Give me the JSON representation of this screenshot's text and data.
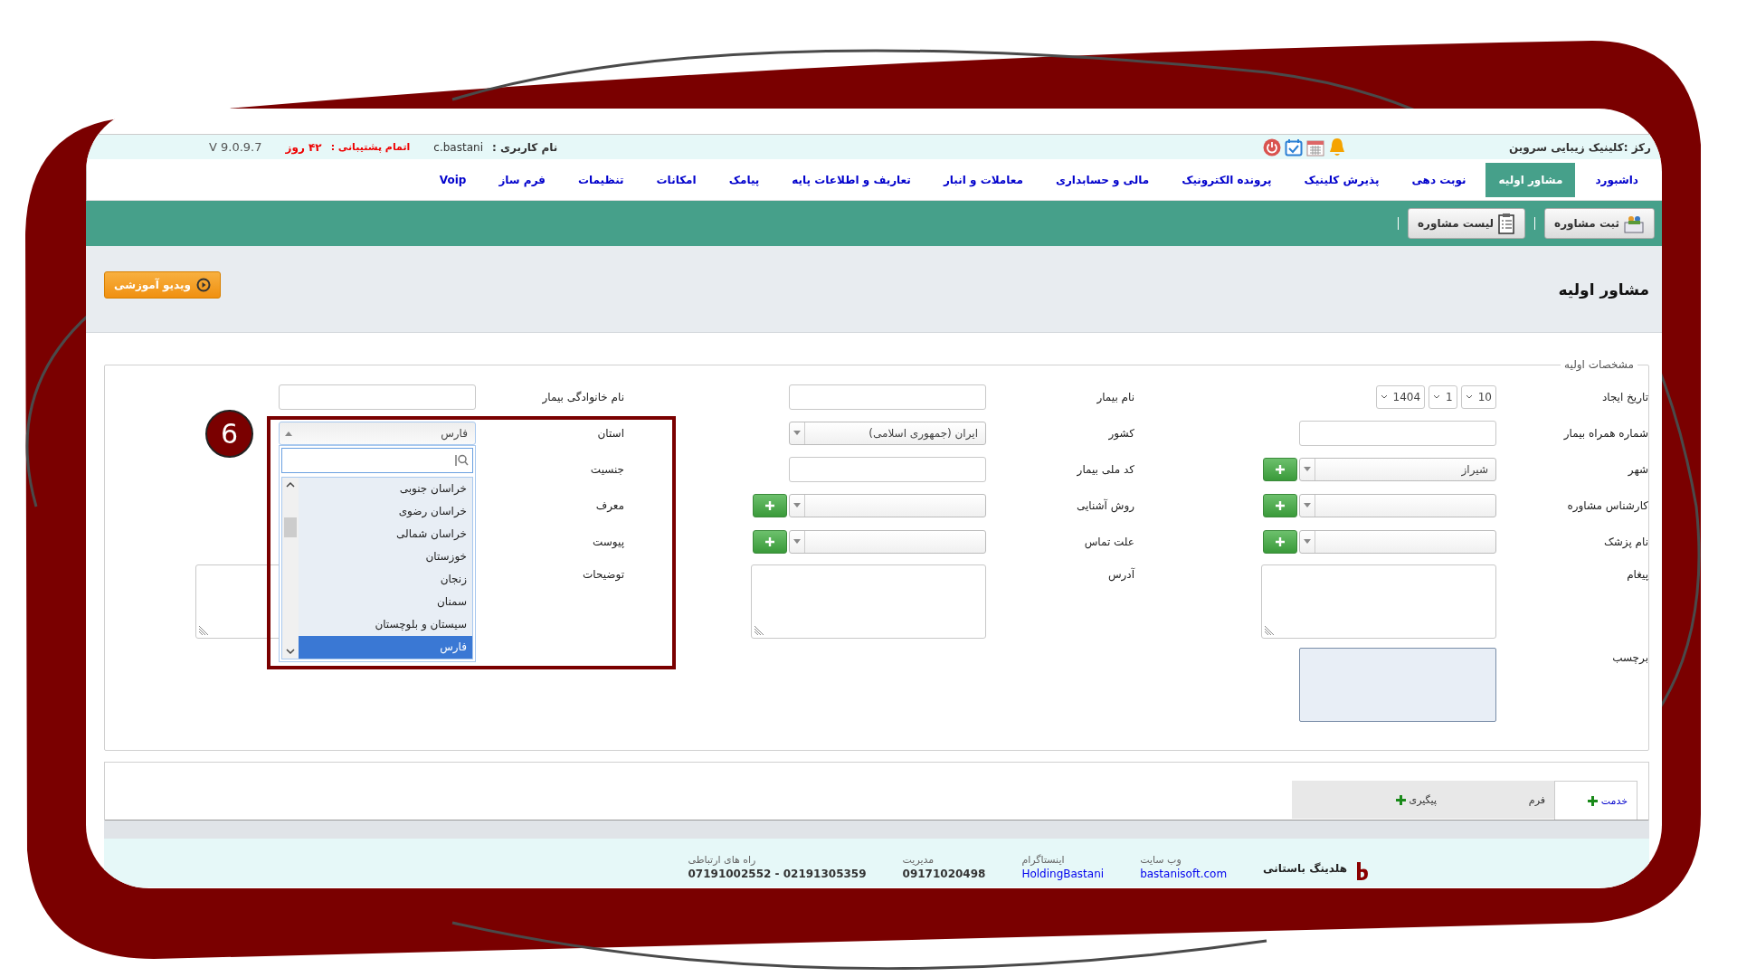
{
  "top_bar": {
    "center": "رکز :کلینیک زیبایی سروین",
    "username_label": "نام کاربری :",
    "username": "c.bastani",
    "support_label": "اتمام پشتیبانی :",
    "support_days": "۴۲ روز",
    "version": "V 9.0.9.7"
  },
  "nav": [
    {
      "label": "داشبورد",
      "selected": false
    },
    {
      "label": "مشاور اولیه",
      "selected": true
    },
    {
      "label": "نوبت دهی",
      "selected": false
    },
    {
      "label": "پذیرش کلینیک",
      "selected": false
    },
    {
      "label": "پرونده الکترونیک",
      "selected": false
    },
    {
      "label": "مالی و حسابداری",
      "selected": false
    },
    {
      "label": "معاملات و انبار",
      "selected": false
    },
    {
      "label": "تعاریف و اطلاعات پایه",
      "selected": false
    },
    {
      "label": "پیامک",
      "selected": false
    },
    {
      "label": "امکانات",
      "selected": false
    },
    {
      "label": "تنظیمات",
      "selected": false
    },
    {
      "label": "فرم ساز",
      "selected": false
    },
    {
      "label": "Voip",
      "selected": false
    }
  ],
  "toolbar": [
    {
      "label": "ثبت مشاوره",
      "kind": "add"
    },
    {
      "label": "لیست مشاوره",
      "kind": "list"
    }
  ],
  "page_title": "مشاور اولیه",
  "video_button": "ویدیو آموزشی",
  "section": {
    "legend": "مشخصات اولیه",
    "rows": [
      [
        {
          "label": "تاریخ ایجاد",
          "kind": "date",
          "parts": [
            "10",
            "1",
            "1404"
          ]
        },
        {
          "label": "نام بیمار",
          "kind": "input"
        },
        {
          "label": "نام خانوادگی بیمار",
          "kind": "input"
        }
      ],
      [
        {
          "label": "شماره همراه بیمار",
          "kind": "input"
        },
        {
          "label": "کشور",
          "kind": "select",
          "value": "ایران (جمهوری اسلامی)"
        },
        {
          "label": "استان",
          "kind": "select",
          "value": "فارس",
          "open": true
        }
      ],
      [
        {
          "label": "شهر",
          "kind": "select",
          "value": "شیراز",
          "add_button": true
        },
        {
          "label": "کد ملی بیمار",
          "kind": "input"
        },
        {
          "label": "جنسیت",
          "kind": "label"
        }
      ],
      [
        {
          "label": "کارشناس مشاوره",
          "kind": "select",
          "add_button": true
        },
        {
          "label": "روش آشنایی",
          "kind": "select",
          "add_button": true
        },
        {
          "label": "معرف",
          "kind": "label"
        }
      ],
      [
        {
          "label": "نام پزشک",
          "kind": "select",
          "add_button": true
        },
        {
          "label": "علت تماس",
          "kind": "select",
          "add_button": true
        },
        {
          "label": "پیوست",
          "kind": "label"
        }
      ],
      [
        {
          "label": "پیغام",
          "kind": "textarea"
        },
        {
          "label": "آدرس",
          "kind": "textarea"
        },
        {
          "label": "توضیحات",
          "kind": "textarea"
        }
      ],
      [
        {
          "label": "برچسب",
          "kind": "tags"
        }
      ]
    ]
  },
  "province_options": [
    {
      "label": "خراسان جنوبی",
      "selected": false
    },
    {
      "label": "خراسان رضوی",
      "selected": false
    },
    {
      "label": "خراسان شمالی",
      "selected": false
    },
    {
      "label": "خوزستان",
      "selected": false
    },
    {
      "label": "زنجان",
      "selected": false
    },
    {
      "label": "سمنان",
      "selected": false
    },
    {
      "label": "سیستان و بلوچستان",
      "selected": false
    },
    {
      "label": "فارس",
      "selected": true
    }
  ],
  "annotation": "6",
  "tabs": [
    {
      "label": "خدمت",
      "selected": true,
      "add": true
    },
    {
      "label": "فرم",
      "selected": false,
      "add": false
    },
    {
      "label": "پیگیری",
      "selected": false,
      "add": true
    }
  ],
  "footer": {
    "company": "هلدینگ باستانی",
    "contacts": [
      {
        "label": "وب سایت",
        "value": "bastanisoft.com",
        "kind": "link"
      },
      {
        "label": "اینستاگرام",
        "value": "HoldingBastani",
        "kind": "link"
      },
      {
        "label": "مدیریت",
        "value": "09171020498",
        "kind": "text"
      },
      {
        "label": "راه های ارتباطی",
        "value": "07191002552 - 02191305359",
        "kind": "text"
      }
    ]
  }
}
